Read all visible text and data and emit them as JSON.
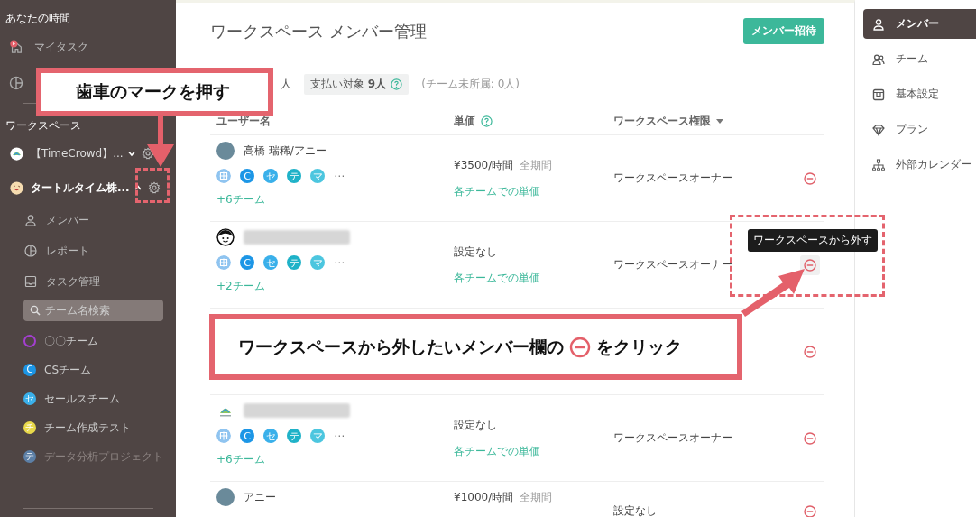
{
  "sidebar": {
    "section_label": "あなたの時間",
    "my_items": [
      {
        "label": "マイタスク"
      }
    ],
    "workspace_label": "ワークスペース",
    "workspaces": [
      {
        "name": "【TimeCrowd】...",
        "kind": "logo",
        "expanded": false
      },
      {
        "name": "タートルタイム株...",
        "kind": "smiley",
        "expanded": true
      }
    ],
    "nav": [
      {
        "label": "メンバー"
      },
      {
        "label": "レポート"
      },
      {
        "label": "タスク管理"
      }
    ],
    "search": {
      "placeholder": "チーム名検索"
    },
    "teams": [
      {
        "label": "〇〇チーム",
        "kind": "ring",
        "color": "#a43fd0",
        "dimmed": false
      },
      {
        "label": "CSチーム",
        "kind": "letter",
        "glyph": "C",
        "color": "#1c96e6",
        "dimmed": false
      },
      {
        "label": "セールスチーム",
        "kind": "letter",
        "glyph": "セ",
        "color": "#3ab0ea",
        "dimmed": false
      },
      {
        "label": "チーム作成テスト",
        "kind": "letter",
        "glyph": "チ",
        "color": "#e8d84a",
        "dimmed": false
      },
      {
        "label": "データ分析プロジェクト",
        "kind": "letter",
        "glyph": "テ",
        "color": "#5c7fa6",
        "dimmed": true
      }
    ]
  },
  "main": {
    "title": "ワークスペース メンバー管理",
    "invite_button": "メンバー招待",
    "summary": {
      "member_count": "人",
      "billing": "支払い対象 **9人**",
      "unassigned": "(チーム未所属: 0人)"
    },
    "columns": [
      "ユーザー名",
      "単価",
      "ワークスペース権限"
    ],
    "rows": [
      {
        "kind": "photo",
        "name": "高橋 瑞稀/アニー",
        "teams": [
          {
            "kind": "pattern",
            "color": "#8fc4f0"
          },
          {
            "kind": "letter",
            "glyph": "C",
            "color": "#1c96e6"
          },
          {
            "kind": "letter",
            "glyph": "セ",
            "color": "#3ab0ea"
          },
          {
            "kind": "letter",
            "glyph": "テ",
            "color": "#1fb2c8"
          },
          {
            "kind": "letter",
            "glyph": "マ",
            "color": "#4cc6df"
          }
        ],
        "overflow": "⋯",
        "more_teams": "+6チーム",
        "rate": "¥3500/時間",
        "period": "全期間",
        "rate_link": "各チームでの単価",
        "role": "ワークスペースオーナー",
        "hovered": false
      },
      {
        "kind": "face",
        "teams": [
          {
            "kind": "pattern",
            "color": "#8fc4f0"
          },
          {
            "kind": "letter",
            "glyph": "C",
            "color": "#1c96e6"
          },
          {
            "kind": "letter",
            "glyph": "セ",
            "color": "#3ab0ea"
          },
          {
            "kind": "letter",
            "glyph": "テ",
            "color": "#1fb2c8"
          },
          {
            "kind": "letter",
            "glyph": "マ",
            "color": "#4cc6df"
          }
        ],
        "overflow": "⋯",
        "more_teams": "+2チーム",
        "rate": "設定なし",
        "rate_link": "各チームでの単価",
        "role": "ワークスペースオーナー",
        "hovered": true,
        "tooltip": "ワークスペースから外す"
      },
      {
        "kind": "covered",
        "teams": [],
        "hovered": false
      },
      {
        "kind": "logo",
        "teams": [
          {
            "kind": "pattern",
            "color": "#8fc4f0"
          },
          {
            "kind": "letter",
            "glyph": "C",
            "color": "#1c96e6"
          },
          {
            "kind": "letter",
            "glyph": "セ",
            "color": "#3ab0ea"
          },
          {
            "kind": "letter",
            "glyph": "テ",
            "color": "#1fb2c8"
          },
          {
            "kind": "letter",
            "glyph": "マ",
            "color": "#4cc6df"
          }
        ],
        "overflow": "⋯",
        "more_teams": "+6チーム",
        "rate": "設定なし",
        "rate_link": "各チームでの単価",
        "role": "ワークスペースオーナー",
        "hovered": false
      },
      {
        "kind": "photo",
        "name": "アニー",
        "teams": [],
        "rate": "¥1000/時間",
        "period": "全期間",
        "role": "設定なし",
        "hovered": false
      }
    ]
  },
  "settings_nav": [
    {
      "label": "メンバー",
      "selected": true
    },
    {
      "label": "チーム",
      "selected": false
    },
    {
      "label": "基本設定",
      "selected": false
    },
    {
      "label": "プラン",
      "selected": false
    },
    {
      "label": "外部カレンダー",
      "selected": false
    }
  ],
  "annotations": {
    "gear_callout": "歯車のマークを押す",
    "remove_callout_before": "ワークスペースから外したいメンバー欄の",
    "remove_callout_after": "をクリック"
  }
}
